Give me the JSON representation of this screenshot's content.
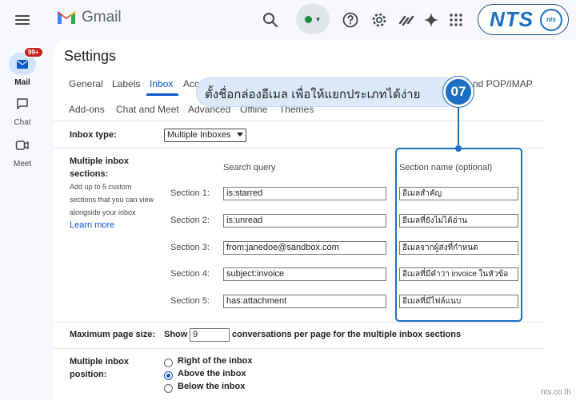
{
  "app": {
    "name": "Gmail"
  },
  "header": {
    "brand_logo_text": "NTS",
    "brand_logo_small": "nts"
  },
  "rail": {
    "mail": {
      "label": "Mail",
      "badge": "99+"
    },
    "chat": {
      "label": "Chat"
    },
    "meet": {
      "label": "Meet"
    }
  },
  "settings": {
    "title": "Settings",
    "tabs_row1": [
      "General",
      "Labels",
      "Inbox",
      "Acc",
      "nd POP/IMAP"
    ],
    "tabs_row2": [
      "Add-ons",
      "Chat and Meet",
      "Advanced",
      "Offline",
      "Themes"
    ],
    "active_tab": "Inbox",
    "inbox_type_label": "Inbox type:",
    "inbox_type_value": "Multiple Inboxes",
    "mis_label": "Multiple inbox sections:",
    "mis_help": [
      "Add up to 5 custom",
      "sections that you can view",
      "alongside your inbox"
    ],
    "learn_more": "Learn more",
    "col_query": "Search query",
    "col_name": "Section name (optional)",
    "sections": [
      {
        "label": "Section 1:",
        "query": "is:starred",
        "name": "อีเมลสำคัญ"
      },
      {
        "label": "Section 2:",
        "query": "is:unread",
        "name": "อีเมลที่ยังไม่ได้อ่าน"
      },
      {
        "label": "Section 3:",
        "query": "from:janedoe@sandbox.com",
        "name": "อีเมลจากผู้ส่งที่กำหนด"
      },
      {
        "label": "Section 4:",
        "query": "subject:invoice",
        "name": "อีเมลที่มีคำว่า invoice ในหัวข้อ"
      },
      {
        "label": "Section 5:",
        "query": "has:attachment",
        "name": "อีเมลที่มีไฟล์แนบ"
      }
    ],
    "max_page": {
      "label": "Maximum page size:",
      "show": "Show",
      "value": "9",
      "suffix": "conversations per page for the multiple inbox sections"
    },
    "position": {
      "label": "Multiple inbox position:",
      "options": [
        "Right of the inbox",
        "Above the inbox",
        "Below the inbox"
      ],
      "selected": "Above the inbox"
    }
  },
  "callout": {
    "text": "ตั้งชื่อกล่องอีเมล เพื่อให้แยกประเภทได้ง่าย",
    "step": "07"
  },
  "watermark": "nts.co.th",
  "colors": {
    "accent": "#0b57d0",
    "highlight": "#1a6fc4",
    "badge": "#c5221f"
  }
}
